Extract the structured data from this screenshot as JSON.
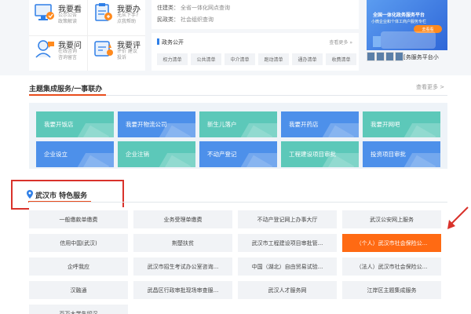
{
  "quick": [
    {
      "title": "我要看",
      "sub": "公示公告\n政策解读",
      "icon": "monitor-icon"
    },
    {
      "title": "我要办",
      "sub": "无从下手?\n点我帮助",
      "icon": "clipboard-icon"
    },
    {
      "title": "我要问",
      "sub": "在线咨询\n咨询留言",
      "icon": "consult-icon"
    },
    {
      "title": "我要评",
      "sub": "评价 建议\n投诉",
      "icon": "review-icon"
    }
  ],
  "info": [
    {
      "key": "住建类：",
      "value": "全省一体化网点查询"
    },
    {
      "key": "民政类：",
      "value": "社会组织查询"
    }
  ],
  "gov": {
    "title": "政务公开",
    "more": "查看更多 »",
    "tags": [
      "权力清单",
      "公共清单",
      "中介清单",
      "跑动清单",
      "通办清单",
      "收费清单"
    ]
  },
  "banner": {
    "line1": "全国一体化政务服务平台",
    "line2": "小微企业和个体工商户服务专栏",
    "button": "去看看",
    "thumbs_text": "[务服务平台小"
  },
  "theme": {
    "title": "主题集成服务/一事联办",
    "more": "查看更多 >",
    "cards": [
      "我要开饭店",
      "我要开物流公司",
      "新生儿落户",
      "我要开药店",
      "我要开网吧",
      "企业设立",
      "企业注销",
      "不动产登记",
      "工程建设项目审批",
      "投资项目审批"
    ]
  },
  "wuhan": {
    "title": "武汉市 特色服务",
    "items": [
      "一般缴款单缴费",
      "业务受理单缴费",
      "不动产登记网上办事大厅",
      "武汉公安网上服务",
      "信用中国(武汉)",
      "荆楚扶贫",
      "武汉市工程建设项目审批管...",
      "（个人）武汉市社会保险公...",
      "企呼我应",
      "武汉市招生考试办公室咨询...",
      "中国（湖北）自由贸易试验...",
      "（法人）武汉市社会保险公...",
      "汉融通",
      "武昌区行政审批现场审查服...",
      "武汉人才服务网",
      "江岸区主题集成服务",
      "百万大学生留汉"
    ],
    "active_item": "（个人）武汉市社会保险公..."
  },
  "colors": {
    "accent": "#e94c1c",
    "active": "#ff6a13",
    "highlight_border": "#d9322b",
    "card_green": "#5cc8b9",
    "card_blue": "#4d90ea"
  }
}
